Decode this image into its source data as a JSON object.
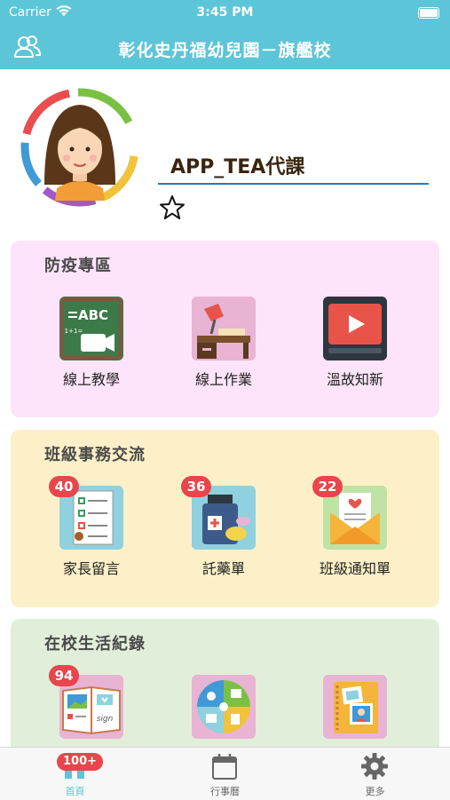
{
  "status_bar": {
    "carrier": "Carrier",
    "time": "3:45 PM"
  },
  "header": {
    "title": "彰化史丹福幼兒園－旗艦校",
    "left_icon": "profile-switch-icon"
  },
  "profile": {
    "name": "APP_TEA代課",
    "favorite_icon": "star-outline-icon"
  },
  "sections": [
    {
      "title": "防疫專區",
      "background": "#fde4fb",
      "items": [
        {
          "label": "線上教學",
          "icon": "chalkboard-video-icon",
          "badge": ""
        },
        {
          "label": "線上作業",
          "icon": "desk-lamp-icon",
          "badge": ""
        },
        {
          "label": "溫故知新",
          "icon": "video-play-icon",
          "badge": ""
        }
      ]
    },
    {
      "title": "班級事務交流",
      "background": "#fdf0c8",
      "items": [
        {
          "label": "家長留言",
          "icon": "checklist-icon",
          "badge": "40"
        },
        {
          "label": "託藥單",
          "icon": "medicine-icon",
          "badge": "36"
        },
        {
          "label": "班級通知單",
          "icon": "envelope-letter-icon",
          "badge": "22"
        }
      ]
    },
    {
      "title": "在校生活紀錄",
      "background": "#e1efda",
      "items": [
        {
          "label": "",
          "icon": "photo-book-icon",
          "badge": "94"
        },
        {
          "label": "",
          "icon": "activity-wheel-icon",
          "badge": ""
        },
        {
          "label": "",
          "icon": "photo-album-icon",
          "badge": ""
        }
      ]
    }
  ],
  "tab_bar": {
    "tabs": [
      {
        "label": "首頁",
        "icon": "home-icon",
        "badge": "100+",
        "active": true
      },
      {
        "label": "行事曆",
        "icon": "calendar-icon",
        "badge": "",
        "active": false
      },
      {
        "label": "更多",
        "icon": "gear-icon",
        "badge": "",
        "active": false
      }
    ]
  },
  "colors": {
    "primary": "#5cc5d8",
    "badge": "#e8454c",
    "underline": "#1f7bbf"
  }
}
